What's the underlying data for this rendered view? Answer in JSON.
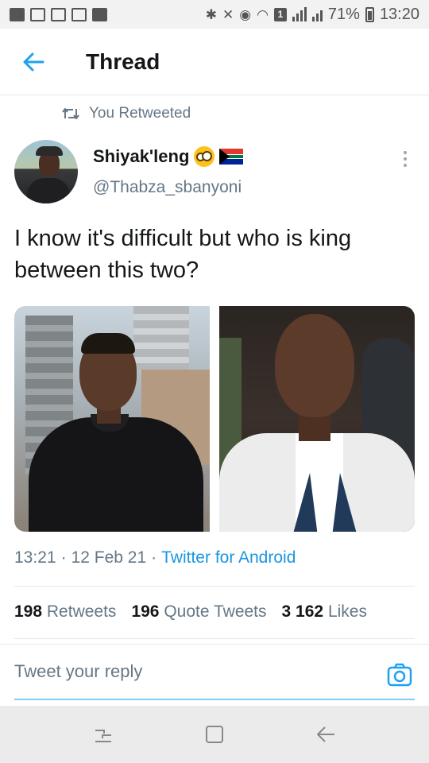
{
  "status_bar": {
    "battery": "71%",
    "time": "13:20",
    "sim_slot": "1"
  },
  "header": {
    "title": "Thread",
    "back_icon": "arrow-left-icon",
    "accent": "#1da1f2"
  },
  "retweet": {
    "label": "You Retweeted",
    "icon": "retweet-icon"
  },
  "tweet": {
    "author_name": "Shiyak'leng",
    "author_handle": "@Thabza_sbanyoni",
    "name_emojis": [
      "flushed-face-emoji",
      "south-africa-flag-emoji"
    ],
    "text": "I know it's difficult but who is king between this two?",
    "media": [
      "photo-1",
      "photo-2"
    ],
    "time": "13:21",
    "date": "12 Feb 21",
    "source": "Twitter for Android",
    "separator": "·"
  },
  "stats": {
    "retweets_count": "198",
    "retweets_label": "Retweets",
    "quotes_count": "196",
    "quotes_label": "Quote Tweets",
    "likes_count": "3 162",
    "likes_label": "Likes"
  },
  "reply": {
    "placeholder": "Tweet your reply",
    "camera_icon": "camera-icon"
  },
  "navbar": {
    "recent": "recent-apps-icon",
    "home": "home-icon",
    "back": "back-icon"
  }
}
